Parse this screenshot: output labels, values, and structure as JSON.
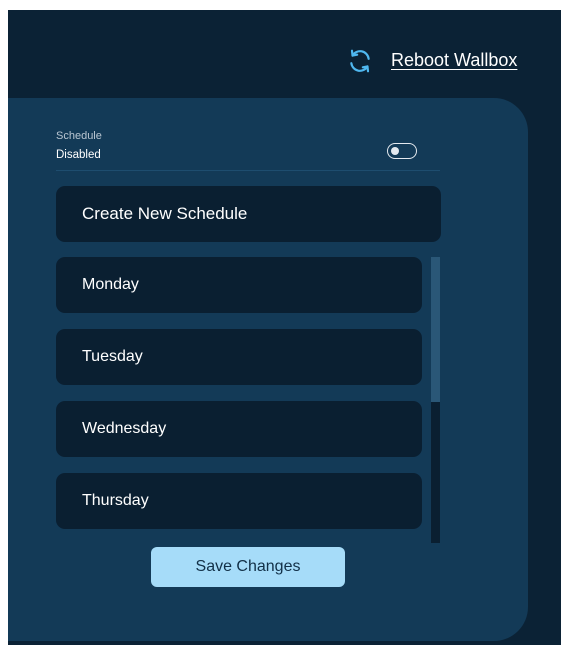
{
  "header": {
    "reboot_label": "Reboot Wallbox",
    "reboot_icon": "refresh-icon"
  },
  "schedule": {
    "title": "Schedule",
    "status": "Disabled",
    "enabled": false
  },
  "create_label": "Create New Schedule",
  "days": [
    "Monday",
    "Tuesday",
    "Wednesday",
    "Thursday"
  ],
  "save_label": "Save Changes",
  "colors": {
    "background": "#0b2235",
    "panel": "#133a57",
    "row": "#0a1f31",
    "accent": "#a6dcf9",
    "icon": "#4fb8f0"
  }
}
